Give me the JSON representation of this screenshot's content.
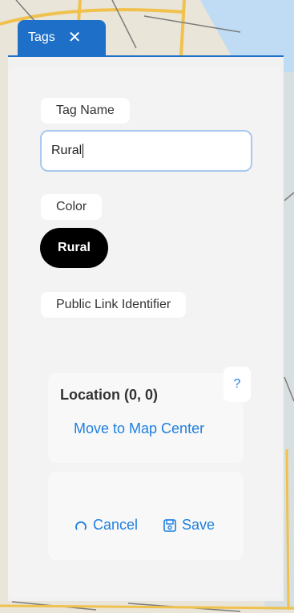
{
  "tab": {
    "title": "Tags",
    "close_glyph": "✕"
  },
  "form": {
    "tag_name_label": "Tag Name",
    "tag_name_value": "Rural",
    "color_label": "Color",
    "color_chip_text": "Rural",
    "color_chip_bg": "#000000",
    "public_link_label": "Public Link Identifier"
  },
  "location": {
    "title": "Location (0, 0)",
    "help_glyph": "?",
    "move_link": "Move to Map Center"
  },
  "actions": {
    "cancel_label": "Cancel",
    "save_label": "Save"
  },
  "colors": {
    "accent": "#1e6fc8",
    "link": "#1e7fe0"
  }
}
